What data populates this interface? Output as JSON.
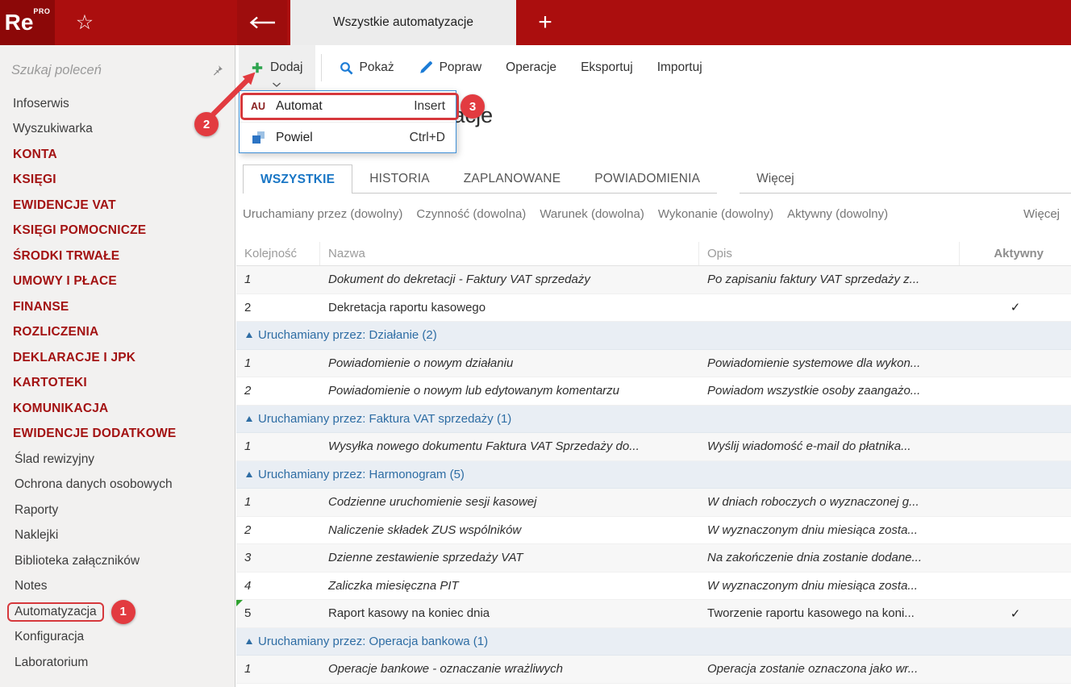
{
  "topbar": {
    "logo_text": "Re",
    "logo_sup": "PRO",
    "active_tab": "Wszystkie automatyzacje"
  },
  "icons": {
    "favorite": "☆",
    "new_tab": "+",
    "check": "✓"
  },
  "sidebar": {
    "search_placeholder": "Szukaj poleceń",
    "items": [
      {
        "label": "Infoserwis",
        "type": "item"
      },
      {
        "label": "Wyszukiwarka",
        "type": "item"
      },
      {
        "label": "KONTA",
        "type": "category"
      },
      {
        "label": "KSIĘGI",
        "type": "category"
      },
      {
        "label": "EWIDENCJE VAT",
        "type": "category"
      },
      {
        "label": "KSIĘGI POMOCNICZE",
        "type": "category"
      },
      {
        "label": "ŚRODKI TRWAŁE",
        "type": "category"
      },
      {
        "label": "UMOWY I PŁACE",
        "type": "category"
      },
      {
        "label": "FINANSE",
        "type": "category"
      },
      {
        "label": "ROZLICZENIA",
        "type": "category"
      },
      {
        "label": "DEKLARACJE I JPK",
        "type": "category"
      },
      {
        "label": "KARTOTEKI",
        "type": "category"
      },
      {
        "label": "KOMUNIKACJA",
        "type": "category"
      },
      {
        "label": "EWIDENCJE DODATKOWE",
        "type": "category"
      },
      {
        "label": "Ślad rewizyjny",
        "type": "sub"
      },
      {
        "label": "Ochrona danych osobowych",
        "type": "sub"
      },
      {
        "label": "Raporty",
        "type": "sub"
      },
      {
        "label": "Naklejki",
        "type": "sub"
      },
      {
        "label": "Biblioteka załączników",
        "type": "sub"
      },
      {
        "label": "Notes",
        "type": "sub"
      },
      {
        "label": "Automatyzacja",
        "type": "sub",
        "selected": true,
        "annotation": "1"
      },
      {
        "label": "Konfiguracja",
        "type": "sub"
      },
      {
        "label": "Laboratorium",
        "type": "sub"
      }
    ]
  },
  "page_title": "Wszystkie automatyzacje",
  "toolbar": {
    "add_label": "Dodaj",
    "show_label": "Pokaż",
    "edit_label": "Popraw",
    "operations_label": "Operacje",
    "export_label": "Eksportuj",
    "import_label": "Importuj"
  },
  "dropdown_menu": {
    "items": [
      {
        "icon": "automat-au-icon",
        "icon_text": "AU",
        "label": "Automat",
        "shortcut": "Insert",
        "annotated": true
      },
      {
        "icon": "duplicate-icon",
        "label": "Powiel",
        "shortcut": "Ctrl+D"
      }
    ]
  },
  "view_tabs": [
    {
      "label": "WSZYSTKIE",
      "active": true
    },
    {
      "label": "HISTORIA"
    },
    {
      "label": "ZAPLANOWANE"
    },
    {
      "label": "POWIADOMIENIA"
    },
    {
      "label": "Więcej",
      "more": true
    }
  ],
  "filters": [
    "Uruchamiany przez (dowolny)",
    "Czynność (dowolna)",
    "Warunek (dowolna)",
    "Wykonanie (dowolny)",
    "Aktywny (dowolny)",
    "Więcej"
  ],
  "table": {
    "columns": [
      "Kolejność",
      "Nazwa",
      "Opis",
      "Aktywny"
    ],
    "rows": [
      {
        "type": "data",
        "order": "1",
        "name": "Dokument do dekretacji - Faktury VAT sprzedaży",
        "desc": "Po zapisaniu faktury VAT sprzedaży z...",
        "italic": true,
        "active": false
      },
      {
        "type": "data",
        "order": "2",
        "name": "Dekretacja raportu kasowego",
        "desc": "",
        "italic": false,
        "active": true
      },
      {
        "type": "group",
        "label": "Uruchamiany przez: Działanie (2)"
      },
      {
        "type": "data",
        "order": "1",
        "name": "Powiadomienie o nowym działaniu",
        "desc": "Powiadomienie systemowe dla wykon...",
        "italic": true,
        "active": false
      },
      {
        "type": "data",
        "order": "2",
        "name": "Powiadomienie o nowym lub edytowanym komentarzu",
        "desc": "Powiadom wszystkie osoby zaangażo...",
        "italic": true,
        "active": false
      },
      {
        "type": "group",
        "label": "Uruchamiany przez: Faktura VAT sprzedaży (1)"
      },
      {
        "type": "data",
        "order": "1",
        "name": "Wysyłka nowego dokumentu Faktura VAT Sprzedaży do...",
        "desc": "Wyślij wiadomość e-mail do płatnika...",
        "italic": true,
        "active": false
      },
      {
        "type": "group",
        "label": "Uruchamiany przez: Harmonogram (5)"
      },
      {
        "type": "data",
        "order": "1",
        "name": "Codzienne uruchomienie sesji kasowej",
        "desc": "W dniach roboczych o wyznaczonej g...",
        "italic": true,
        "active": false
      },
      {
        "type": "data",
        "order": "2",
        "name": "Naliczenie składek ZUS wspólników",
        "desc": "W wyznaczonym dniu miesiąca zosta...",
        "italic": true,
        "active": false
      },
      {
        "type": "data",
        "order": "3",
        "name": "Dzienne zestawienie sprzedaży VAT",
        "desc": "Na zakończenie dnia zostanie dodane...",
        "italic": true,
        "active": false
      },
      {
        "type": "data",
        "order": "4",
        "name": "Zaliczka miesięczna PIT",
        "desc": "W wyznaczonym dniu miesiąca zosta...",
        "italic": true,
        "active": false
      },
      {
        "type": "data",
        "order": "5",
        "name": "Raport kasowy na koniec dnia",
        "desc": "Tworzenie raportu kasowego na koni...",
        "italic": false,
        "active": true,
        "focused": true
      },
      {
        "type": "group",
        "label": "Uruchamiany przez: Operacja bankowa (1)"
      },
      {
        "type": "data",
        "order": "1",
        "name": "Operacje bankowe - oznaczanie wrażliwych",
        "desc": "Operacja zostanie oznaczona jako wr...",
        "italic": true,
        "active": false
      }
    ]
  },
  "annotations": {
    "step1": "1",
    "step2": "2",
    "step3": "3"
  },
  "colors": {
    "topbar_red": "#ab0e0e",
    "sidebar_category_red": "#a31212",
    "annotation_red": "#e23b40",
    "tab_blue": "#1976c5",
    "group_blue": "#2e6da4",
    "plus_green": "#2da44e",
    "icon_blue": "#1c7cd6",
    "focus_marker_green": "#2fa12f"
  }
}
